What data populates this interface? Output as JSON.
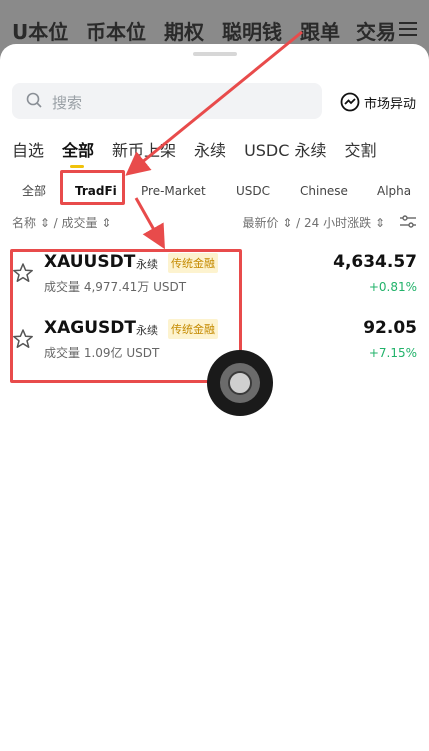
{
  "topnav": {
    "items": [
      "U本位",
      "币本位",
      "期权",
      "聪明钱",
      "跟单",
      "交易"
    ]
  },
  "search": {
    "placeholder": "搜索"
  },
  "movers": {
    "label": "市场异动"
  },
  "tabs_main": [
    "自选",
    "全部",
    "新币上架",
    "永续",
    "USDC 永续",
    "交割"
  ],
  "tabs_main_active": "全部",
  "tabs_sub": [
    "全部",
    "TradFi",
    "Pre-Market",
    "USDC",
    "Chinese",
    "Alpha"
  ],
  "tabs_sub_active": "TradFi",
  "sort": {
    "left": "名称 ⇕ / 成交量 ⇕",
    "right": "最新价 ⇕ / 24 小时涨跌 ⇕"
  },
  "rows": [
    {
      "symbol": "XAUUSDT",
      "perp": "永续",
      "tag": "传统金融",
      "volume": "成交量 4,977.41万 USDT",
      "price": "4,634.57",
      "change": "+0.81%"
    },
    {
      "symbol": "XAGUSDT",
      "perp": "永续",
      "tag": "传统金融",
      "volume": "成交量 1.09亿 USDT",
      "price": "92.05",
      "change": "+7.15%"
    }
  ],
  "colors": {
    "accent": "#f0c20a",
    "highlight": "#e84b4b",
    "positive": "#21b26a",
    "tag_text": "#c48a00",
    "tag_bg": "#fdf3cf"
  }
}
